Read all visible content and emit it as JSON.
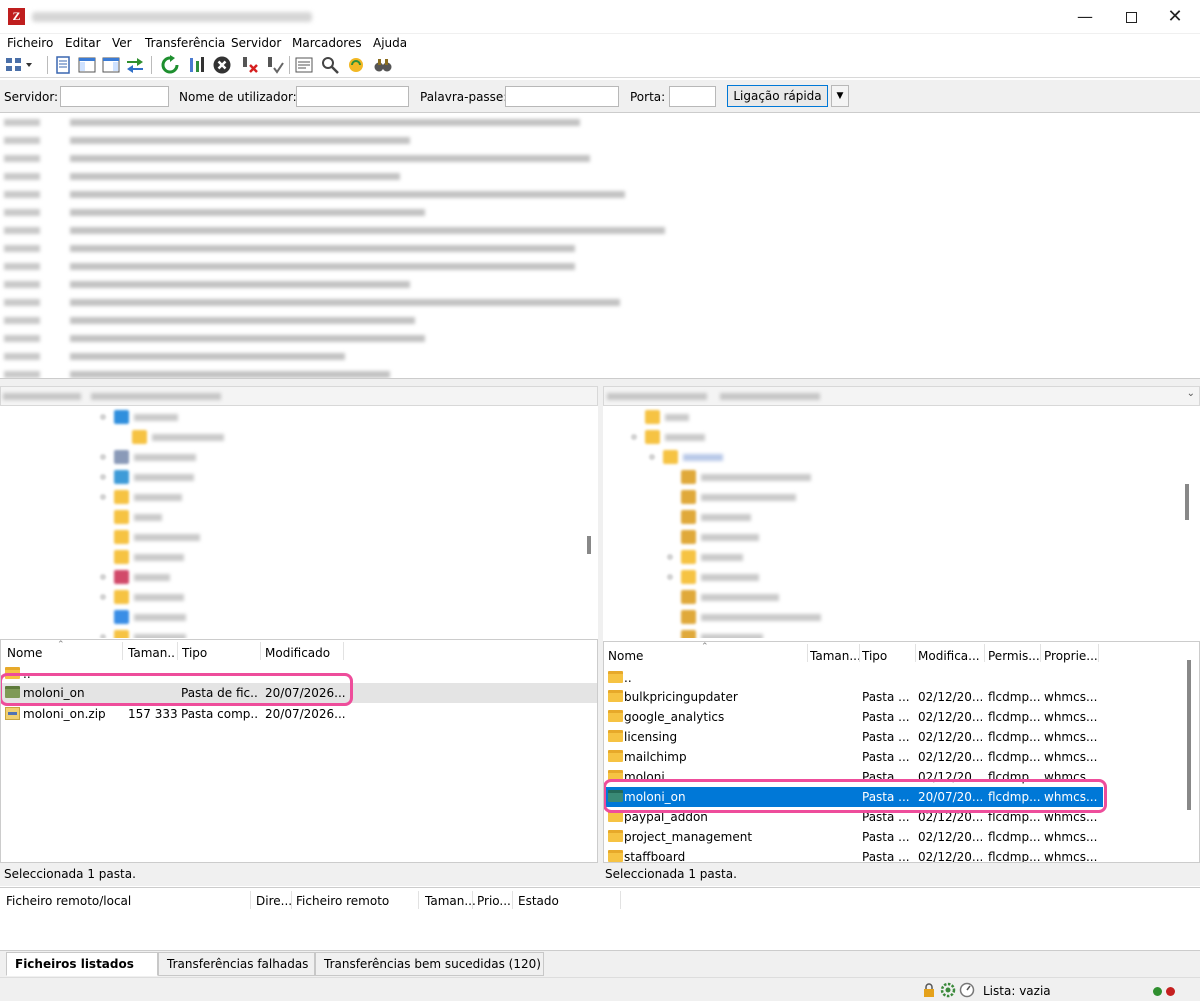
{
  "titlebar": {
    "minimize_icon": "minimize-icon",
    "maximize_icon": "maximize-icon",
    "close_icon": "close-icon"
  },
  "menu": [
    {
      "label": "Ficheiro"
    },
    {
      "label": "Editar"
    },
    {
      "label": "Ver"
    },
    {
      "label": "Transferência"
    },
    {
      "label": "Servidor"
    },
    {
      "label": "Marcadores"
    },
    {
      "label": "Ajuda"
    }
  ],
  "quickconnect": {
    "server_label": "Servidor:",
    "user_label": "Nome de utilizador:",
    "password_label": "Palavra-passe:",
    "port_label": "Porta:",
    "connect_button": "Ligação rápida",
    "server_value": "",
    "user_value": "",
    "password_value": "",
    "port_value": ""
  },
  "local": {
    "columns": [
      "Nome",
      "Taman...",
      "Tipo",
      "Modificado"
    ],
    "rows": [
      {
        "name": "..",
        "size": "",
        "type": "",
        "modified": ""
      },
      {
        "name": "moloni_on",
        "size": "",
        "type": "Pasta de fic...",
        "modified": "20/07/2026..."
      },
      {
        "name": "moloni_on.zip",
        "size": "157 333",
        "type": "Pasta comp...",
        "modified": "20/07/2026..."
      }
    ],
    "status": "Seleccionada 1 pasta."
  },
  "remote": {
    "columns": [
      "Nome",
      "Taman...",
      "Tipo",
      "Modifica...",
      "Permis...",
      "Proprie..."
    ],
    "rows": [
      {
        "name": "..",
        "type": "",
        "modified": "",
        "perms": "",
        "owner": ""
      },
      {
        "name": "bulkpricingupdater",
        "type": "Pasta ...",
        "modified": "02/12/20...",
        "perms": "flcdmp...",
        "owner": "whmcs..."
      },
      {
        "name": "google_analytics",
        "type": "Pasta ...",
        "modified": "02/12/20...",
        "perms": "flcdmp...",
        "owner": "whmcs..."
      },
      {
        "name": "licensing",
        "type": "Pasta ...",
        "modified": "02/12/20...",
        "perms": "flcdmp...",
        "owner": "whmcs..."
      },
      {
        "name": "mailchimp",
        "type": "Pasta ...",
        "modified": "02/12/20...",
        "perms": "flcdmp...",
        "owner": "whmcs..."
      },
      {
        "name": "moloni",
        "type": "Pasta ...",
        "modified": "02/12/20...",
        "perms": "flcdmp...",
        "owner": "whmcs..."
      },
      {
        "name": "moloni_on",
        "type": "Pasta ...",
        "modified": "20/07/20...",
        "perms": "flcdmp...",
        "owner": "whmcs..."
      },
      {
        "name": "paypal_addon",
        "type": "Pasta ...",
        "modified": "02/12/20...",
        "perms": "flcdmp...",
        "owner": "whmcs..."
      },
      {
        "name": "project_management",
        "type": "Pasta ...",
        "modified": "02/12/20...",
        "perms": "flcdmp...",
        "owner": "whmcs..."
      },
      {
        "name": "staffboard",
        "type": "Pasta ...",
        "modified": "02/12/20...",
        "perms": "flcdmp...",
        "owner": "whmcs..."
      }
    ],
    "status": "Seleccionada 1 pasta."
  },
  "queue": {
    "columns": [
      "Ficheiro remoto/local",
      "Dire...",
      "Ficheiro remoto",
      "Taman...",
      "Prio...",
      "Estado"
    ]
  },
  "tabs": [
    {
      "label": "Ficheiros listados"
    },
    {
      "label": "Transferências falhadas"
    },
    {
      "label": "Transferências bem sucedidas (120)"
    }
  ],
  "statusbar": {
    "queue_text": "Lista: vazia"
  },
  "colors": {
    "selection": "#0078d7",
    "highlight": "#ee4d9b",
    "folder": "#f6c343"
  }
}
